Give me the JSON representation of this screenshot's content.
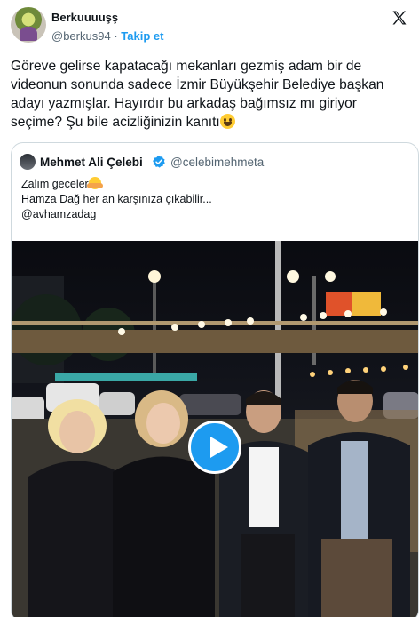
{
  "author": {
    "display_name": "Berkuuuuşş",
    "handle": "@berkus94",
    "separator": "·",
    "follow_label": "Takip et"
  },
  "tweet": {
    "text": "Göreve gelirse kapatacağı mekanları gezmiş adam bir de videonun sonunda sadece İzmir Büyükşehir Belediye başkan adayı yazmışlar. Hayırdır bu arkadaş bağımsız mı giriyor seçime? Şu bile acizliğinizin kanıtı",
    "emoji": "grinning-face-emoji"
  },
  "quoted_tweet": {
    "display_name": "Mehmet Ali Çelebi",
    "handle": "@celebimehmeta",
    "line1": "Zalım geceler",
    "line2": "Hamza Dağ her an karşınıza çıkabilir...",
    "line3": "@avhamzadag",
    "verified_color": "#1d9bf0"
  },
  "colors": {
    "accent": "#1d9bf0",
    "text": "#0f1419",
    "secondary": "#536471",
    "border": "#cfd9de"
  },
  "icons": {
    "brand": "x-logo-icon",
    "verified": "verified-badge-icon",
    "media_control": "play-icon"
  }
}
